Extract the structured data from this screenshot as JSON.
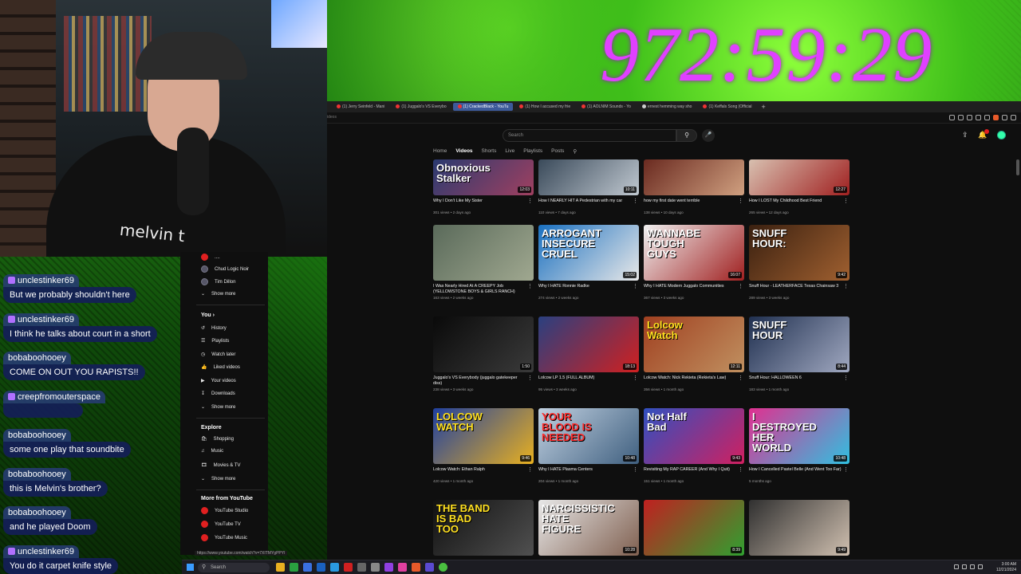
{
  "overlay": {
    "timer": "972:59:29"
  },
  "webcam": {
    "shirt_text": "melvin t"
  },
  "chat": [
    {
      "user": "unclestinker69",
      "text": "But we probably shouldn't here"
    },
    {
      "user": "unclestinker69",
      "text": "I think he talks about court in a short"
    },
    {
      "user": "bobaboohooey",
      "text": "COME ON OUT YOU RAPISTS!!"
    },
    {
      "user": "creepfromouterspace",
      "text": ""
    },
    {
      "user": "bobaboohooey",
      "text": "some one play that soundbite"
    },
    {
      "user": "bobaboohooey",
      "text": "this is Melvin's brother?"
    },
    {
      "user": "bobaboohooey",
      "text": "and he played Doom"
    },
    {
      "user": "unclestinker69",
      "text": "You do it carpet knife style"
    }
  ],
  "browser": {
    "tabs": [
      {
        "label": "(1) Jerry Seinfeld - Mani",
        "active": false
      },
      {
        "label": "(1) Juggalo's VS Everybo",
        "active": false
      },
      {
        "label": "(1) CrackedBlack - YouTu",
        "active": true
      },
      {
        "label": "(1) How I accused my frie",
        "active": false
      },
      {
        "label": "(1) AOLNIM Sounds - Yo",
        "active": false
      },
      {
        "label": "ernest hemming way sho",
        "active": false
      },
      {
        "label": "(1) Keffals Song (Official",
        "active": false
      }
    ],
    "new_tab": "+",
    "address_hint": "ideos"
  },
  "youtube": {
    "search_placeholder": "Search",
    "channel_tabs": [
      "Home",
      "Videos",
      "Shorts",
      "Live",
      "Playlists",
      "Posts"
    ],
    "active_tab": "Videos",
    "sidebar": {
      "subs_partial": "....",
      "subscriptions": [
        "Chud Logic Noir",
        "Tim Dillon"
      ],
      "show_more_1": "Show more",
      "you_heading": "You",
      "you_items": [
        "History",
        "Playlists",
        "Watch later",
        "Liked videos",
        "Your videos",
        "Downloads"
      ],
      "show_more_2": "Show more",
      "explore_heading": "Explore",
      "explore_items": [
        "Shopping",
        "Music",
        "Movies & TV"
      ],
      "show_more_3": "Show more",
      "more_heading": "More from YouTube",
      "more_items": [
        "YouTube Studio",
        "YouTube TV",
        "YouTube Music"
      ]
    },
    "videos": [
      {
        "title": "Why I Don't Like My Sister",
        "meta": "301 views • 2 days ago",
        "duration": "12:03",
        "overlay": "Obnoxious Stalker"
      },
      {
        "title": "How I NEARLY HIT A Pedestrian with my car",
        "meta": "110 views • 7 days ago",
        "duration": "10:11",
        "overlay": ""
      },
      {
        "title": "how my first date went terrible",
        "meta": "138 views • 10 days ago",
        "duration": "",
        "overlay": ""
      },
      {
        "title": "How I LOST My Childhood Best Friend",
        "meta": "265 views • 12 days ago",
        "duration": "12:27",
        "overlay": ""
      },
      {
        "title": "I Was Nearly Hired At A CREEPY Job (YELLOWSTONE BOYS & GIRLS RANCH)",
        "meta": "163 views • 2 weeks ago",
        "duration": "",
        "overlay": ""
      },
      {
        "title": "Why I HATE Ronnie Radke",
        "meta": "274 views • 2 weeks ago",
        "duration": "15:02",
        "overlay": "ARROGANT INSECURE CRUEL"
      },
      {
        "title": "Why I HATE Modern Juggalo Communities",
        "meta": "367 views • 3 weeks ago",
        "duration": "16:07",
        "overlay": "WANNABE TOUGH GUYS"
      },
      {
        "title": "Snuff Hour - LEATHERFACE Texas Chainsaw 3",
        "meta": "289 views • 3 weeks ago",
        "duration": "9:42",
        "overlay": "SNUFF HOUR:"
      },
      {
        "title": "Juggalo's VS Everybody (juggalo gatekeeper diss)",
        "meta": "238 views • 3 weeks ago",
        "duration": "1:50",
        "overlay": ""
      },
      {
        "title": "Lolcow LP 1.5 (FULL ALBUM)",
        "meta": "95 views • 3 weeks ago",
        "duration": "18:13",
        "overlay": ""
      },
      {
        "title": "Lolcow Watch: Nick Rekieta (Rekieta's Law)",
        "meta": "356 views • 1 month ago",
        "duration": "12:11",
        "overlay": "Lolcow Watch"
      },
      {
        "title": "Snuff Hour: HALLOWEEN 6",
        "meta": "183 views • 1 month ago",
        "duration": "8:44",
        "overlay": "SNUFF HOUR"
      },
      {
        "title": "Lolcow Watch: Ethan Ralph",
        "meta": "420 views • 1 month ago",
        "duration": "9:46",
        "overlay": "LOLCOW WATCH"
      },
      {
        "title": "Why I HATE Plasma Centers",
        "meta": "204 views • 1 month ago",
        "duration": "10:48",
        "overlay": "YOUR BLOOD IS NEEDED"
      },
      {
        "title": "Revisiting My RAP CAREER (And Why I Quit)",
        "meta": "151 views • 1 month ago",
        "duration": "9:43",
        "overlay": "Not Half Bad"
      },
      {
        "title": "How I Cancelled Pastel Belle (And Went Too Far)",
        "meta": "",
        "duration": "10:48",
        "overlay": "I DESTROYED HER WORLD"
      },
      {
        "title": "",
        "meta": "",
        "duration": "",
        "overlay": "THE BAND IS BAD TOO"
      },
      {
        "title": "",
        "meta": "",
        "duration": "10:28",
        "overlay": "NARCISSISTIC HATE FIGURE"
      },
      {
        "title": "",
        "meta": "",
        "duration": "8:39",
        "overlay": ""
      },
      {
        "title": "",
        "meta": "",
        "duration": "9:49",
        "overlay": ""
      }
    ],
    "last_meta": "5 months ago",
    "status_url": "https://www.youtube.com/watch?v=7XITMYgPPYI"
  },
  "taskbar": {
    "search": "Search",
    "time": "3:00 AM",
    "date": "12/21/2024"
  },
  "colors": {
    "timer": "#e040ff",
    "chat_bubble": "#14205a",
    "yt_red": "#e02020"
  }
}
